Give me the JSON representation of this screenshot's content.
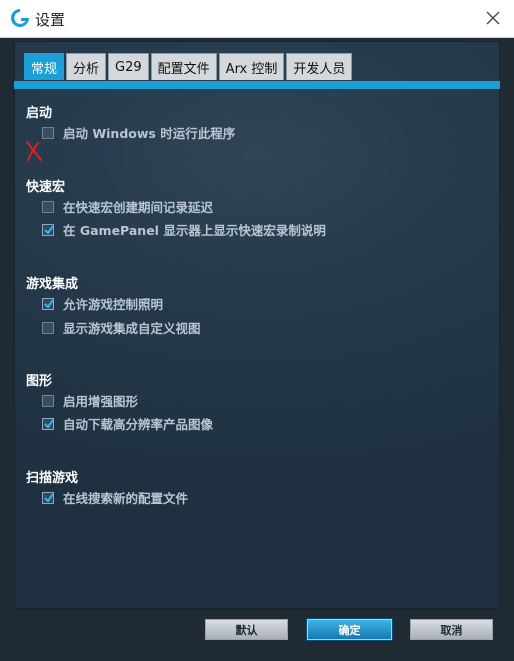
{
  "window": {
    "title": "设置"
  },
  "tabs": [
    {
      "label": "常规",
      "active": true
    },
    {
      "label": "分析",
      "active": false
    },
    {
      "label": "G29",
      "active": false
    },
    {
      "label": "配置文件",
      "active": false
    },
    {
      "label": "Arx 控制",
      "active": false
    },
    {
      "label": "开发人员",
      "active": false
    }
  ],
  "sections": {
    "startup": {
      "title": "启动",
      "options": [
        {
          "label": "启动 Windows 时运行此程序",
          "checked": false
        }
      ]
    },
    "macros": {
      "title": "快速宏",
      "options": [
        {
          "label": "在快速宏创建期间记录延迟",
          "checked": false
        },
        {
          "label": "在 GamePanel 显示器上显示快速宏录制说明",
          "checked": true
        }
      ]
    },
    "game_integration": {
      "title": "游戏集成",
      "options": [
        {
          "label": "允许游戏控制照明",
          "checked": true
        },
        {
          "label": "显示游戏集成自定义视图",
          "checked": false
        }
      ]
    },
    "graphics": {
      "title": "图形",
      "options": [
        {
          "label": "启用增强图形",
          "checked": false
        },
        {
          "label": "自动下载高分辨率产品图像",
          "checked": true
        }
      ]
    },
    "scan_games": {
      "title": "扫描游戏",
      "options": [
        {
          "label": "在线搜索新的配置文件",
          "checked": true
        }
      ]
    }
  },
  "buttons": {
    "default": "默认",
    "ok": "确定",
    "cancel": "取消"
  },
  "colors": {
    "accent": "#1c9fd6",
    "annotation": "#e02020"
  }
}
